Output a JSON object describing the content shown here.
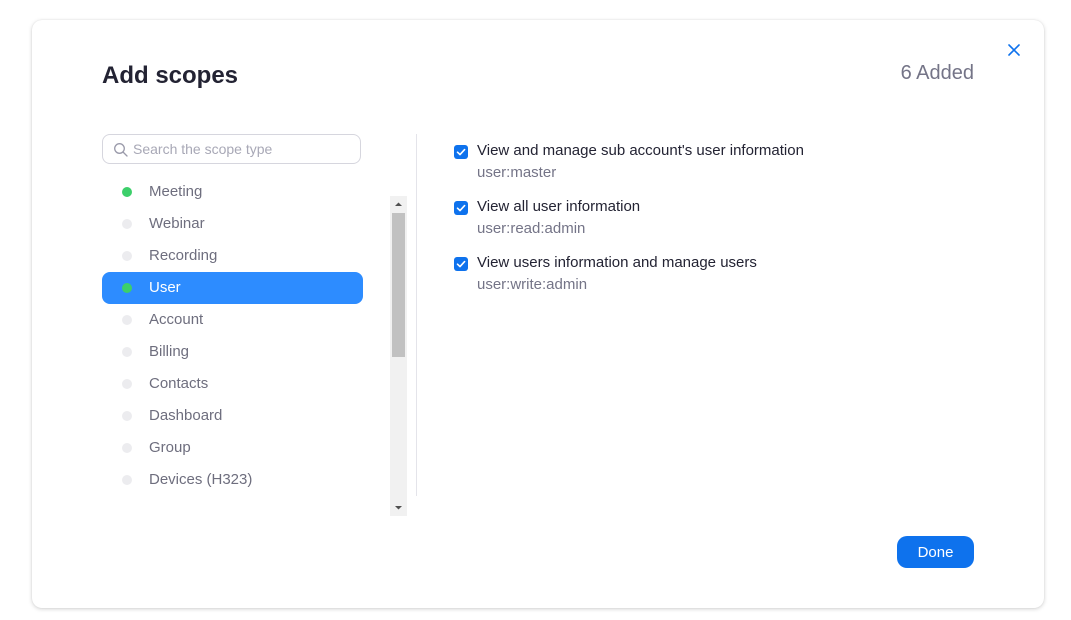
{
  "dialog": {
    "title": "Add scopes",
    "added_count": "6 Added"
  },
  "search": {
    "placeholder": "Search the scope type",
    "value": ""
  },
  "categories": [
    {
      "label": "Meeting",
      "has_scopes": true,
      "selected": false
    },
    {
      "label": "Webinar",
      "has_scopes": false,
      "selected": false
    },
    {
      "label": "Recording",
      "has_scopes": false,
      "selected": false
    },
    {
      "label": "User",
      "has_scopes": true,
      "selected": true
    },
    {
      "label": "Account",
      "has_scopes": false,
      "selected": false
    },
    {
      "label": "Billing",
      "has_scopes": false,
      "selected": false
    },
    {
      "label": "Contacts",
      "has_scopes": false,
      "selected": false
    },
    {
      "label": "Dashboard",
      "has_scopes": false,
      "selected": false
    },
    {
      "label": "Group",
      "has_scopes": false,
      "selected": false
    },
    {
      "label": "Devices (H323)",
      "has_scopes": false,
      "selected": false
    }
  ],
  "scopes": [
    {
      "name": "View and manage sub account's user information",
      "key": "user:master",
      "checked": true
    },
    {
      "name": "View all user information",
      "key": "user:read:admin",
      "checked": true
    },
    {
      "name": "View users information and manage users",
      "key": "user:write:admin",
      "checked": true
    }
  ],
  "footer": {
    "done_label": "Done"
  },
  "colors": {
    "accent": "#0e72ed",
    "selected_row": "#2d8cff",
    "active_dot": "#3ccf6a",
    "inactive_dot": "#ececef"
  }
}
